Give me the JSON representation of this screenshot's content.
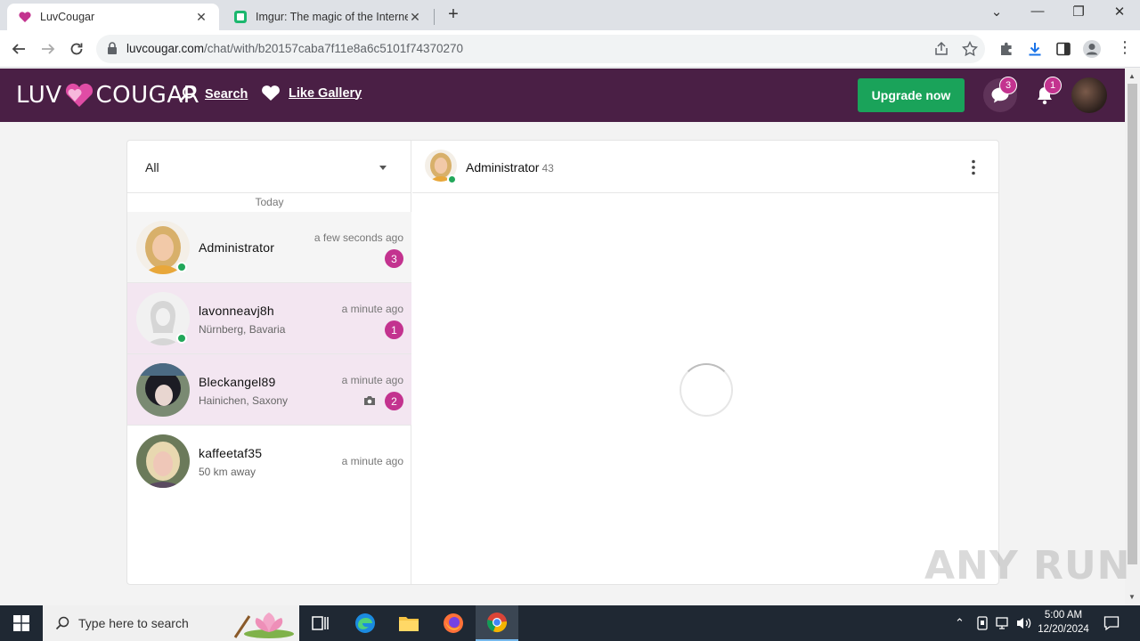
{
  "browser": {
    "tabs": [
      {
        "title": "LuvCougar",
        "active": true
      },
      {
        "title": "Imgur: The magic of the Internet",
        "active": false
      }
    ],
    "url_host": "luvcougar.com",
    "url_path": "/chat/with/b20157caba7f11e8a6c5101f74370270"
  },
  "site": {
    "logo_left": "LUV",
    "logo_right": "COUGAR",
    "nav": {
      "search": "Search",
      "like_gallery": "Like Gallery"
    },
    "upgrade": "Upgrade now",
    "messages_badge": "3",
    "notifications_badge": "1"
  },
  "chat": {
    "filter": "All",
    "day_label": "Today",
    "conversations": [
      {
        "name": "Administrator",
        "subtitle": "",
        "time": "a few seconds ago",
        "count": "3",
        "online": true,
        "has_photo": false
      },
      {
        "name": "lavonneavj8h",
        "subtitle": "Nürnberg, Bavaria",
        "time": "a minute ago",
        "count": "1",
        "online": true,
        "has_photo": false
      },
      {
        "name": "Bleckangel89",
        "subtitle": "Hainichen, Saxony",
        "time": "a minute ago",
        "count": "2",
        "online": false,
        "has_photo": true
      },
      {
        "name": "kaffeetaf35",
        "subtitle": "50 km away",
        "time": "a minute ago",
        "count": "",
        "online": false,
        "has_photo": false
      }
    ],
    "thread": {
      "name": "Administrator",
      "age": "43"
    }
  },
  "taskbar": {
    "search_placeholder": "Type here to search",
    "time": "5:00 AM",
    "date": "12/20/2024"
  },
  "watermark": "ANY RUN"
}
